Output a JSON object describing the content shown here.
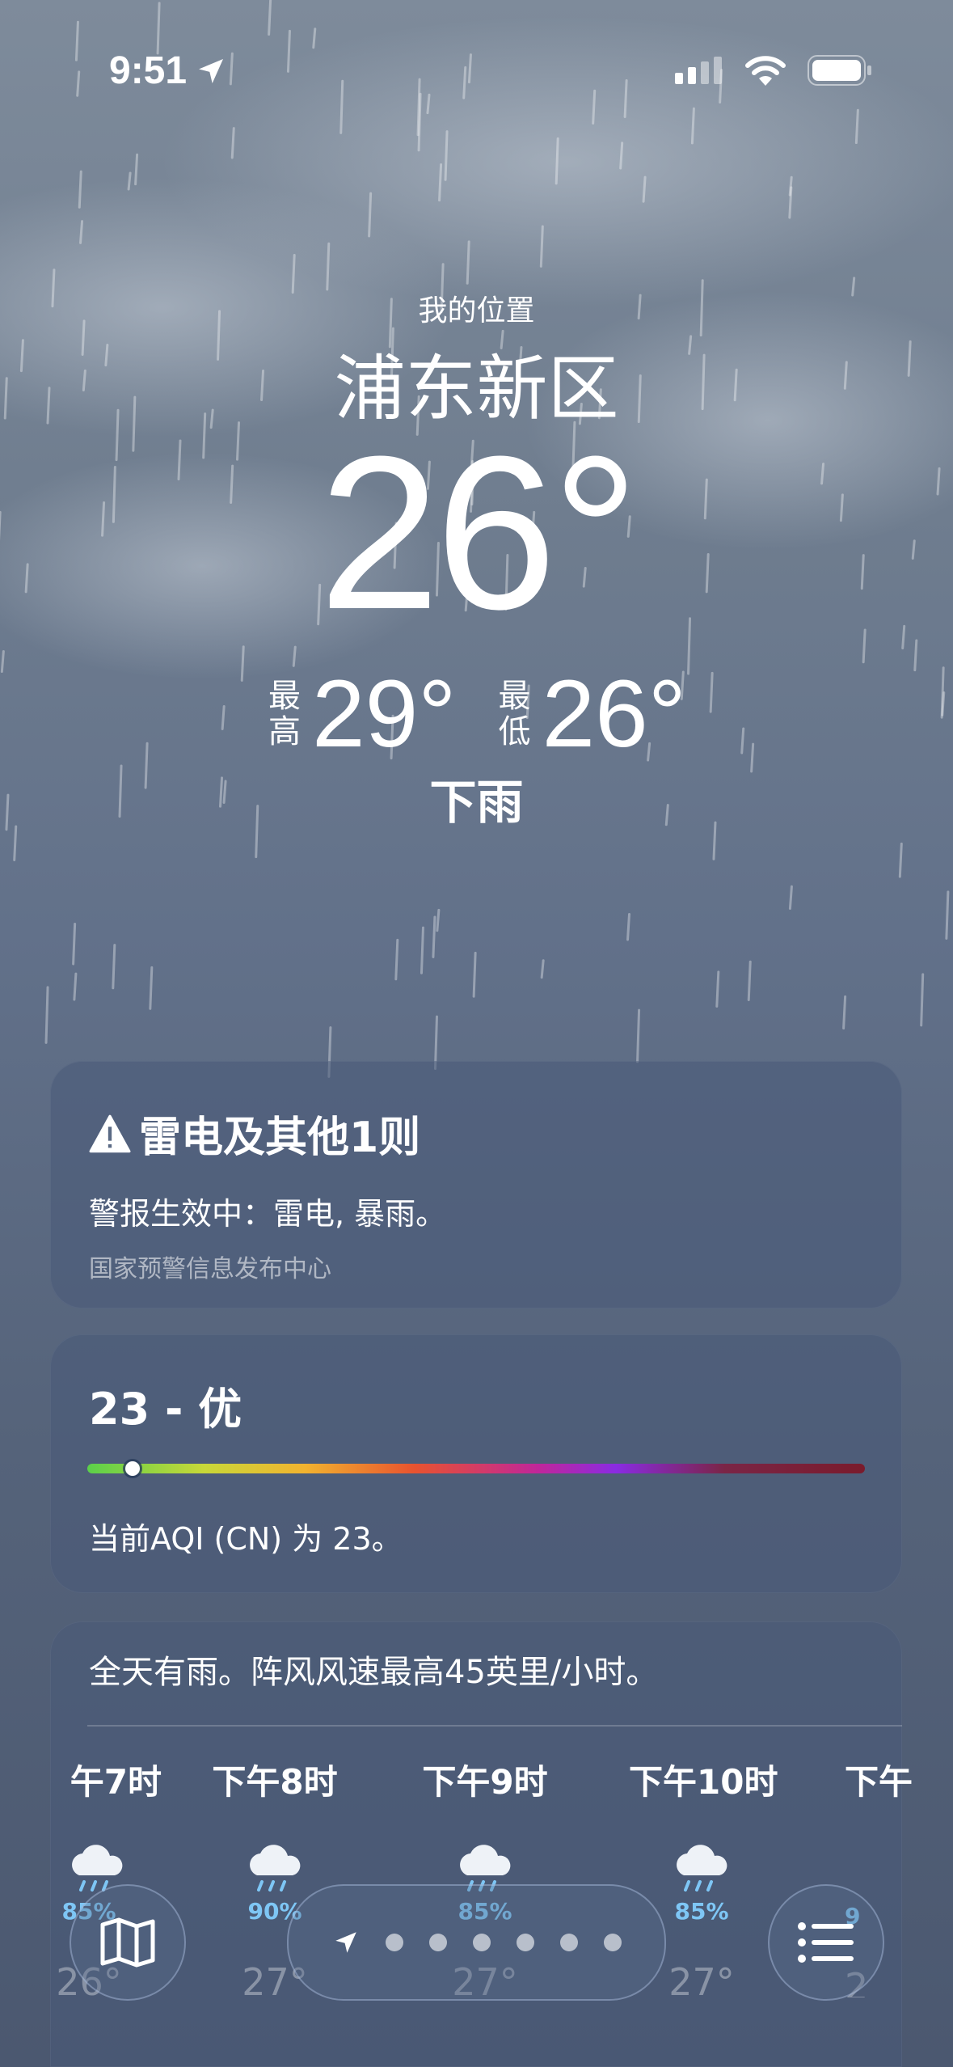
{
  "status_bar": {
    "time": "9:51"
  },
  "header": {
    "my_location": "我的位置",
    "city": "浦东新区",
    "current_temp": "26°",
    "high_tag": "最高",
    "high_temp": "29°",
    "low_tag": "最低",
    "low_temp": "26°",
    "condition": "下雨"
  },
  "alert_card": {
    "title": "雷电及其他1则",
    "body": "警报生效中：雷电, 暴雨。",
    "source": "国家预警信息发布中心"
  },
  "aqi_card": {
    "title": "23 - 优",
    "value": 23,
    "description": "当前AQI (CN) 为 23。"
  },
  "forecast_card": {
    "summary": "全天有雨。阵风风速最高45英里/小时。",
    "hours": [
      {
        "label": "午7时",
        "percent": "85%",
        "temp": "26°"
      },
      {
        "label": "下午8时",
        "percent": "90%",
        "temp": "27°"
      },
      {
        "label": "下午9时",
        "percent": "85%",
        "temp": "27°"
      },
      {
        "label": "下午10时",
        "percent": "85%",
        "temp": "27°"
      },
      {
        "label": "下午",
        "percent": "9",
        "temp": "2"
      }
    ]
  },
  "colors": {
    "precip_blue": "#7ec6f5",
    "background_top": "#7e8b9b",
    "background_bottom": "#4b5870"
  },
  "icons": [
    "location-arrow-icon",
    "signal-icon",
    "wifi-icon",
    "battery-icon",
    "warning-icon",
    "rain-cloud-icon",
    "map-icon",
    "list-icon"
  ]
}
